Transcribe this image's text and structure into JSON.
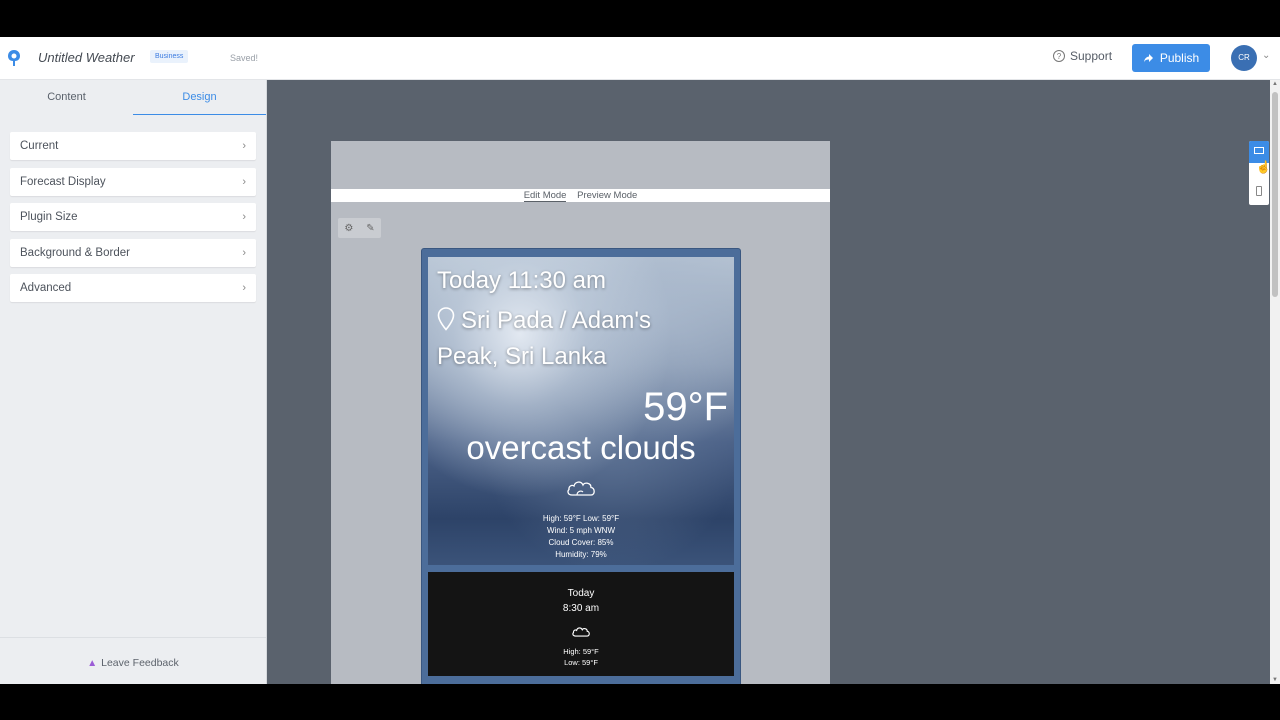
{
  "header": {
    "app_title": "Untitled Weather",
    "plan_badge": "Business",
    "save_status": "Saved!",
    "support_label": "Support",
    "publish_label": "Publish",
    "avatar_initials": "CR"
  },
  "sidebar": {
    "tabs": [
      {
        "label": "Content"
      },
      {
        "label": "Design"
      }
    ],
    "active_tab": "Design",
    "items": [
      {
        "label": "Current"
      },
      {
        "label": "Forecast Display"
      },
      {
        "label": "Plugin Size"
      },
      {
        "label": "Background & Border"
      },
      {
        "label": "Advanced"
      }
    ],
    "feedback_label": "Leave Feedback"
  },
  "canvas": {
    "edit_mode_label": "Edit Mode",
    "preview_mode_label": "Preview Mode"
  },
  "widget": {
    "current": {
      "time": "Today 11:30 am",
      "location": "Sri Pada / Adam's Peak, Sri Lanka",
      "temperature": "59°F",
      "description": "overcast clouds",
      "icon": "cloud-icon",
      "high_low": "High: 59°F Low: 59°F",
      "wind": "Wind: 5 mph WNW",
      "cloud_cover": "Cloud Cover: 85%",
      "humidity": "Humidity: 79%"
    },
    "forecast": [
      {
        "day": "Today",
        "time": "8:30 am",
        "icon": "cloud-icon",
        "high": "High: 59°F",
        "low": "Low: 59°F"
      }
    ]
  },
  "colors": {
    "accent": "#3c8ce6",
    "canvas_bg": "#5a626d",
    "widget_border": "#4c6d9a",
    "forecast_bg": "#141414"
  }
}
